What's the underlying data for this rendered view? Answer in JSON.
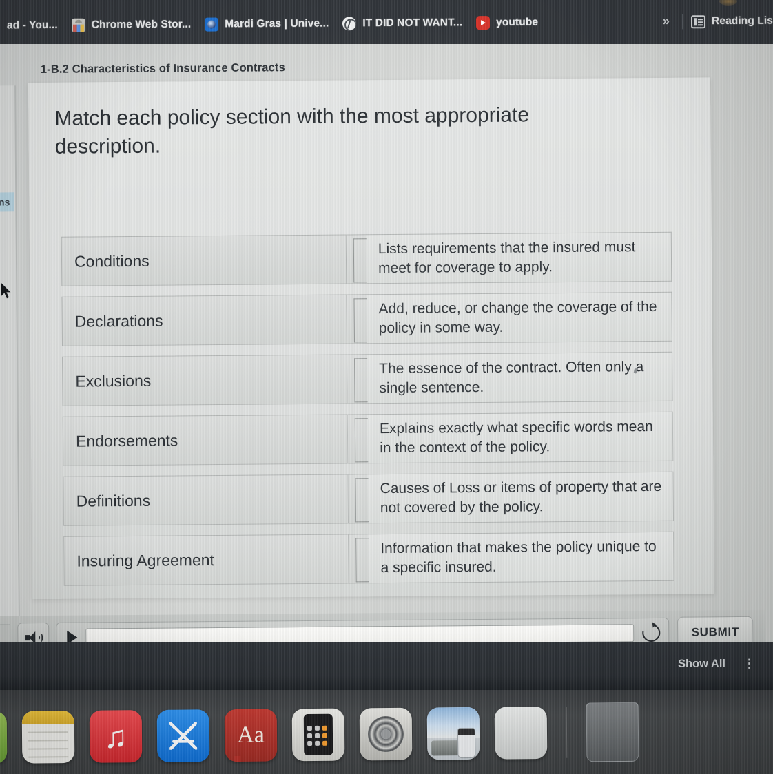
{
  "browser": {
    "tabs": [
      {
        "title": "ad - You...",
        "icon": ""
      },
      {
        "title": "Chrome Web Stor...",
        "icon": "chrome-web-store-icon"
      },
      {
        "title": "Mardi Gras | Unive...",
        "icon": "mardi-gras-favicon"
      },
      {
        "title": "IT DID NOT WANT...",
        "icon": "globe-favicon"
      },
      {
        "title": "youtube",
        "icon": "youtube-favicon"
      }
    ],
    "overflow_label": "»",
    "reading_list_label": "Reading Lis"
  },
  "sidebar": {
    "active_item_label": "ions"
  },
  "lesson": {
    "title": "1-B.2 Characteristics of Insurance Contracts",
    "prompt": "Match each policy section with the most appropriate description."
  },
  "match_rows": [
    {
      "term": "Conditions",
      "description": "Lists requirements that the insured must meet for coverage to apply."
    },
    {
      "term": "Declarations",
      "description": "Add, reduce, or change the coverage of the policy in some way."
    },
    {
      "term": "Exclusions",
      "description": "The essence of the contract. Often only a single sentence."
    },
    {
      "term": "Endorsements",
      "description": "Explains exactly what specific words mean in the context of the policy."
    },
    {
      "term": "Definitions",
      "description": "Causes of Loss or items of property that are not covered by the policy."
    },
    {
      "term": "Insuring Agreement",
      "description": "Information that makes the policy unique to a specific insured."
    }
  ],
  "player": {
    "volume_icon": "speaker-icon",
    "play_icon": "play-icon",
    "reset_icon": "reset-icon",
    "submit_label": "SUBMIT"
  },
  "overlay_bar": {
    "show_all_label": "Show All",
    "extra_label": "⋮"
  },
  "dock": {
    "items": [
      {
        "name": "notes-app-icon",
        "label": "Notes"
      },
      {
        "name": "music-app-icon",
        "label": "Music"
      },
      {
        "name": "app-store-icon",
        "label": "App Store"
      },
      {
        "name": "dictionary-app-icon",
        "label": "Dictionary"
      },
      {
        "name": "calculator-app-icon",
        "label": "Calculator"
      },
      {
        "name": "system-preferences-icon",
        "label": "System Preferences"
      },
      {
        "name": "photos-app-icon",
        "label": "Photos"
      },
      {
        "name": "finder-window-icon",
        "label": "Finder"
      },
      {
        "name": "trash-icon",
        "label": "Trash"
      }
    ]
  },
  "colors": {
    "tabstrip_bg": "#31353a",
    "page_bg": "#d2d4d3",
    "card_bg": "#e6e8e7",
    "sidebar_highlight": "#b6d3e0",
    "text_dark": "#2b3035",
    "dock_bg": "#45484a"
  }
}
